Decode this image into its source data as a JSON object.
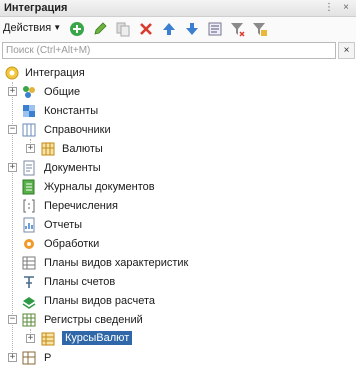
{
  "window": {
    "title": "Интеграция"
  },
  "toolbar": {
    "actions_label": "Действия"
  },
  "search": {
    "placeholder": "Поиск (Ctrl+Alt+M)",
    "clear_label": "×"
  },
  "tree": [
    {
      "label": "Интеграция",
      "icon": "config-root-icon",
      "expander": "",
      "level": 0
    },
    {
      "label": "Общие",
      "icon": "common-icon",
      "expander": "+",
      "level": 1
    },
    {
      "label": "Константы",
      "icon": "constants-icon",
      "expander": "",
      "level": 1
    },
    {
      "label": "Справочники",
      "icon": "catalogs-icon",
      "expander": "−",
      "level": 1
    },
    {
      "label": "Валюты",
      "icon": "catalog-item-icon",
      "expander": "+",
      "level": 2
    },
    {
      "label": "Документы",
      "icon": "documents-icon",
      "expander": "+",
      "level": 1
    },
    {
      "label": "Журналы документов",
      "icon": "doc-journals-icon",
      "expander": "",
      "level": 1
    },
    {
      "label": "Перечисления",
      "icon": "enums-icon",
      "expander": "",
      "level": 1
    },
    {
      "label": "Отчеты",
      "icon": "reports-icon",
      "expander": "",
      "level": 1
    },
    {
      "label": "Обработки",
      "icon": "data-processors-icon",
      "expander": "",
      "level": 1
    },
    {
      "label": "Планы видов характеристик",
      "icon": "char-types-icon",
      "expander": "",
      "level": 1
    },
    {
      "label": "Планы счетов",
      "icon": "chart-of-accounts-icon",
      "expander": "",
      "level": 1
    },
    {
      "label": "Планы видов расчета",
      "icon": "calc-types-icon",
      "expander": "",
      "level": 1
    },
    {
      "label": "Регистры сведений",
      "icon": "info-registers-icon",
      "expander": "−",
      "level": 1
    },
    {
      "label": "КурсыВалют",
      "icon": "register-item-icon",
      "expander": "+",
      "level": 2,
      "selected": true
    },
    {
      "label": "Р",
      "icon": "accumulation-registers-icon",
      "expander": "+",
      "level": 1
    }
  ]
}
